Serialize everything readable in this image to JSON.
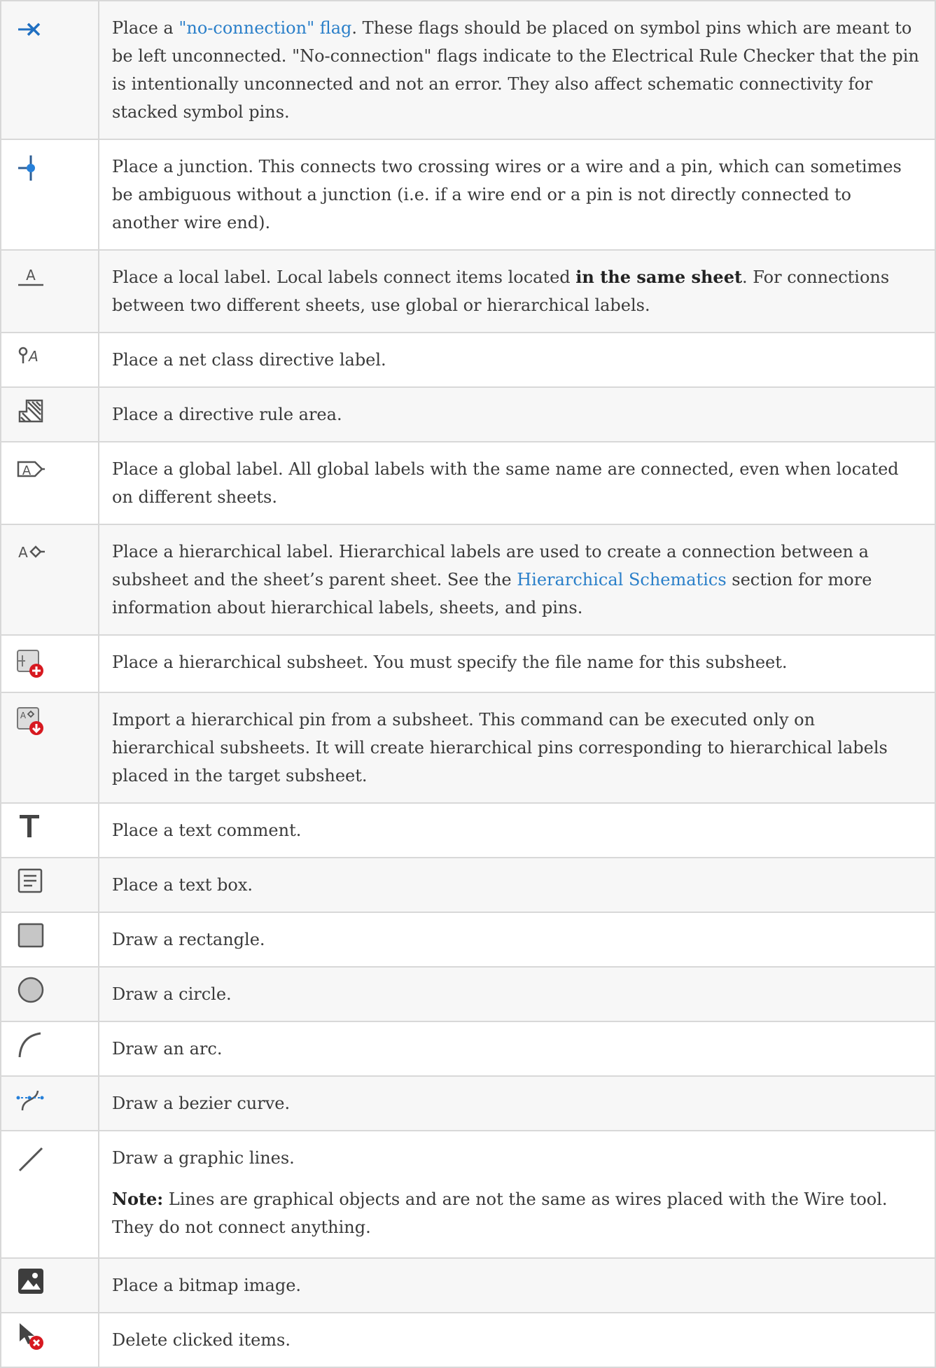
{
  "rows": [
    {
      "icon": "no-connection-flag-icon",
      "parts": [
        "Place a ",
        "\"no-connection\" flag",
        ". These flags should be placed on symbol pins which are meant to be left unconnected. \"No-connection\" flags indicate to the Electrical Rule Checker that the pin is intentionally unconnected and not an error. They also affect schematic connectivity for stacked symbol pins."
      ]
    },
    {
      "icon": "junction-icon",
      "text": "Place a junction. This connects two crossing wires or a wire and a pin, which can sometimes be ambiguous without a junction (i.e. if a wire end or a pin is not directly connected to another wire end)."
    },
    {
      "icon": "local-label-icon",
      "parts": [
        "Place a local label. Local labels connect items located ",
        "in the same sheet",
        ". For connections between two different sheets, use global or hierarchical labels."
      ]
    },
    {
      "icon": "net-class-directive-icon",
      "text": "Place a net class directive label."
    },
    {
      "icon": "rule-area-icon",
      "text": "Place a directive rule area."
    },
    {
      "icon": "global-label-icon",
      "text": "Place a global label. All global labels with the same name are connected, even when located on different sheets."
    },
    {
      "icon": "hierarchical-label-icon",
      "parts": [
        "Place a hierarchical label. Hierarchical labels are used to create a connection between a subsheet and the sheet’s parent sheet. See the ",
        "Hierarchical Schematics",
        " section for more information about hierarchical labels, sheets, and pins."
      ]
    },
    {
      "icon": "hierarchical-subsheet-icon",
      "text": "Place a hierarchical subsheet. You must specify the file name for this subsheet."
    },
    {
      "icon": "import-hierarchical-pin-icon",
      "text": "Import a hierarchical pin from a subsheet. This command can be executed only on hierarchical subsheets. It will create hierarchical pins corresponding to hierarchical labels placed in the target subsheet."
    },
    {
      "icon": "text-comment-icon",
      "text": "Place a text comment."
    },
    {
      "icon": "text-box-icon",
      "text": "Place a text box."
    },
    {
      "icon": "rectangle-icon",
      "text": "Draw a rectangle."
    },
    {
      "icon": "circle-icon",
      "text": "Draw a circle."
    },
    {
      "icon": "arc-icon",
      "text": "Draw an arc."
    },
    {
      "icon": "bezier-curve-icon",
      "text": "Draw a bezier curve."
    },
    {
      "icon": "graphic-line-icon",
      "text": "Draw a graphic lines.",
      "note_label": "Note:",
      "note_text": " Lines are graphical objects and are not the same as wires placed with the Wire tool. They do not connect anything."
    },
    {
      "icon": "bitmap-image-icon",
      "text": "Place a bitmap image."
    },
    {
      "icon": "delete-items-icon",
      "text": "Delete clicked items."
    }
  ]
}
